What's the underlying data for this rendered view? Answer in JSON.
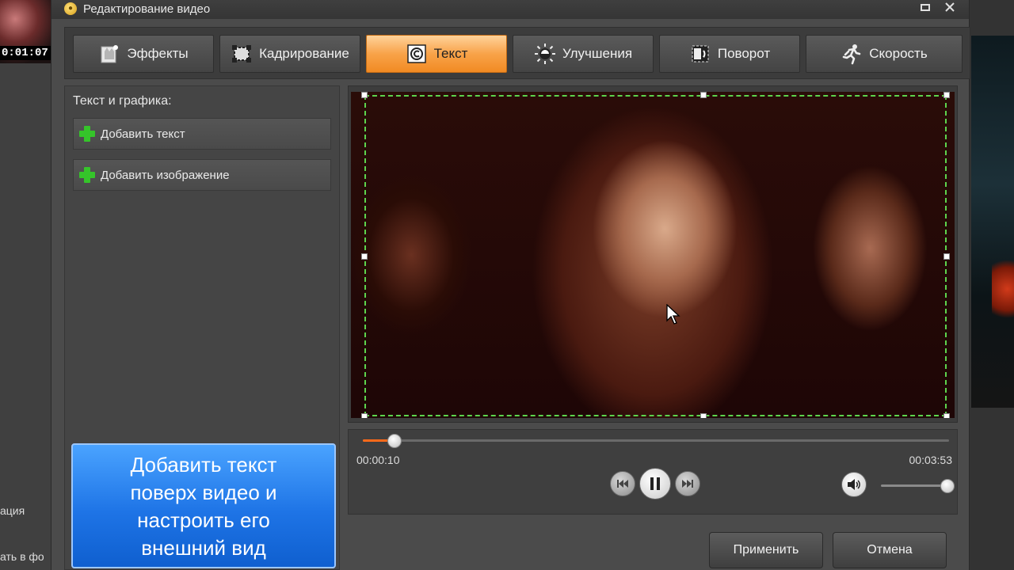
{
  "background": {
    "timecode": "0:01:07",
    "label_1": "ация",
    "label_2": "ать в фо"
  },
  "dialog": {
    "title": "Редактирование видео",
    "minimize_icon": "minimize-icon",
    "close_icon": "close-icon"
  },
  "tabs": [
    {
      "label": "Эффекты",
      "icon": "effects-icon",
      "active": false
    },
    {
      "label": "Кадрирование",
      "icon": "crop-icon",
      "active": false
    },
    {
      "label": "Текст",
      "icon": "copyright-icon",
      "active": true
    },
    {
      "label": "Улучшения",
      "icon": "brightness-icon",
      "active": false
    },
    {
      "label": "Поворот",
      "icon": "rotate-icon",
      "active": false
    },
    {
      "label": "Скорость",
      "icon": "running-man-icon",
      "active": false
    }
  ],
  "left_panel": {
    "header": "Текст и графика:",
    "add_text": "Добавить текст",
    "add_image": "Добавить изображение"
  },
  "player": {
    "current_time": "00:00:10",
    "total_time": "00:03:53",
    "progress": 0.043,
    "volume": 1.0
  },
  "actions": {
    "apply": "Применить",
    "cancel": "Отмена"
  },
  "callout": {
    "line_1": "Добавить текст",
    "line_2": "поверх видео и",
    "line_3": "настроить его",
    "line_4": "внешний вид"
  },
  "colors": {
    "accent_tab": "#f18a23",
    "callout_blue": "#1e74e6",
    "selection_green": "#5dd44d",
    "progress_orange": "#ff6a1a"
  }
}
